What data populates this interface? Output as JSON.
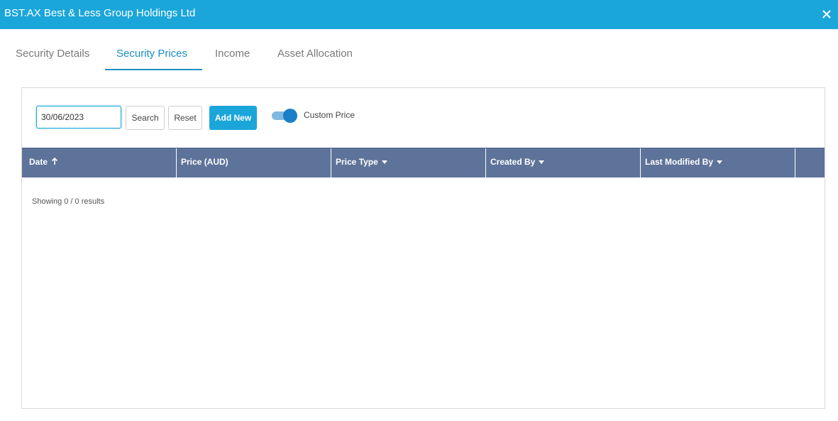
{
  "window": {
    "title": "BST.AX Best & Less Group Holdings Ltd",
    "close_icon": "close-icon"
  },
  "tabs": [
    {
      "label": "Security Details",
      "active": false
    },
    {
      "label": "Security Prices",
      "active": true
    },
    {
      "label": "Income",
      "active": false
    },
    {
      "label": "Asset Allocation",
      "active": false
    }
  ],
  "toolbar": {
    "date_value": "30/06/2023",
    "search_label": "Search",
    "reset_label": "Reset",
    "add_new_label": "Add New",
    "custom_price_label": "Custom Price",
    "custom_price_on": true
  },
  "table": {
    "columns": [
      {
        "label": "Date",
        "sort": "ascending"
      },
      {
        "label": "Price (AUD)",
        "sort": "none"
      },
      {
        "label": "Price Type",
        "sort": "dropdown"
      },
      {
        "label": "Created By",
        "sort": "dropdown"
      },
      {
        "label": "Last Modified By",
        "sort": "dropdown"
      }
    ],
    "rows": [],
    "results_text": "Showing 0 / 0 results"
  },
  "colors": {
    "accent": "#1ba6da",
    "header_bg": "#5e7399",
    "active_tab": "#1b8fc7"
  }
}
